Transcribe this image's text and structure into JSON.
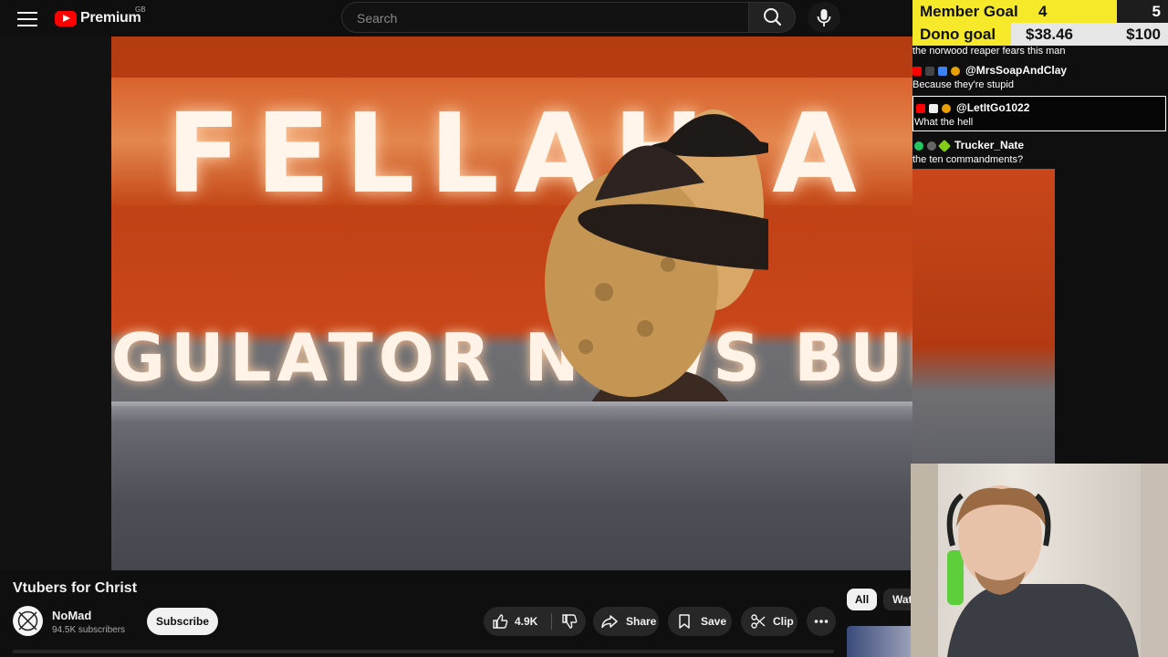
{
  "header": {
    "logo_text": "Premium",
    "region": "GB",
    "search_placeholder": "Search",
    "icons": [
      "hamburger-icon",
      "youtube-icon",
      "search-icon",
      "mic-icon"
    ]
  },
  "video": {
    "banner_top_text": "FELLAH A",
    "banner_bottom_text": "GULATOR NEWS   BUNGU"
  },
  "stream_overlay": {
    "member_goal": {
      "label": "Member Goal",
      "current": "4",
      "target": "5",
      "progress": 0.8
    },
    "dono_goal": {
      "label": "Dono goal",
      "current": "$38.46",
      "target": "$100",
      "progress": 0.3846
    },
    "colors": {
      "goal_fill": "#f5e92a"
    },
    "chat": [
      {
        "user": "",
        "text": "the norwood reaper fears this man"
      },
      {
        "user": "@MrsSoapAndClay",
        "text": "Because they're stupid"
      },
      {
        "user": "@LetItGo1022",
        "text": "What the hell",
        "highlighted": true
      },
      {
        "user": "Trucker_Nate",
        "text": "the ten commandments?"
      }
    ]
  },
  "below_video": {
    "title": "Vtubers for Christ",
    "channel_name": "NoMad",
    "subscribers": "94.5K subscribers",
    "subscribe_label": "Subscribe",
    "likes": "4.9K",
    "share_label": "Share",
    "save_label": "Save",
    "clip_label": "Clip",
    "chips": [
      "All",
      "Wat"
    ]
  }
}
